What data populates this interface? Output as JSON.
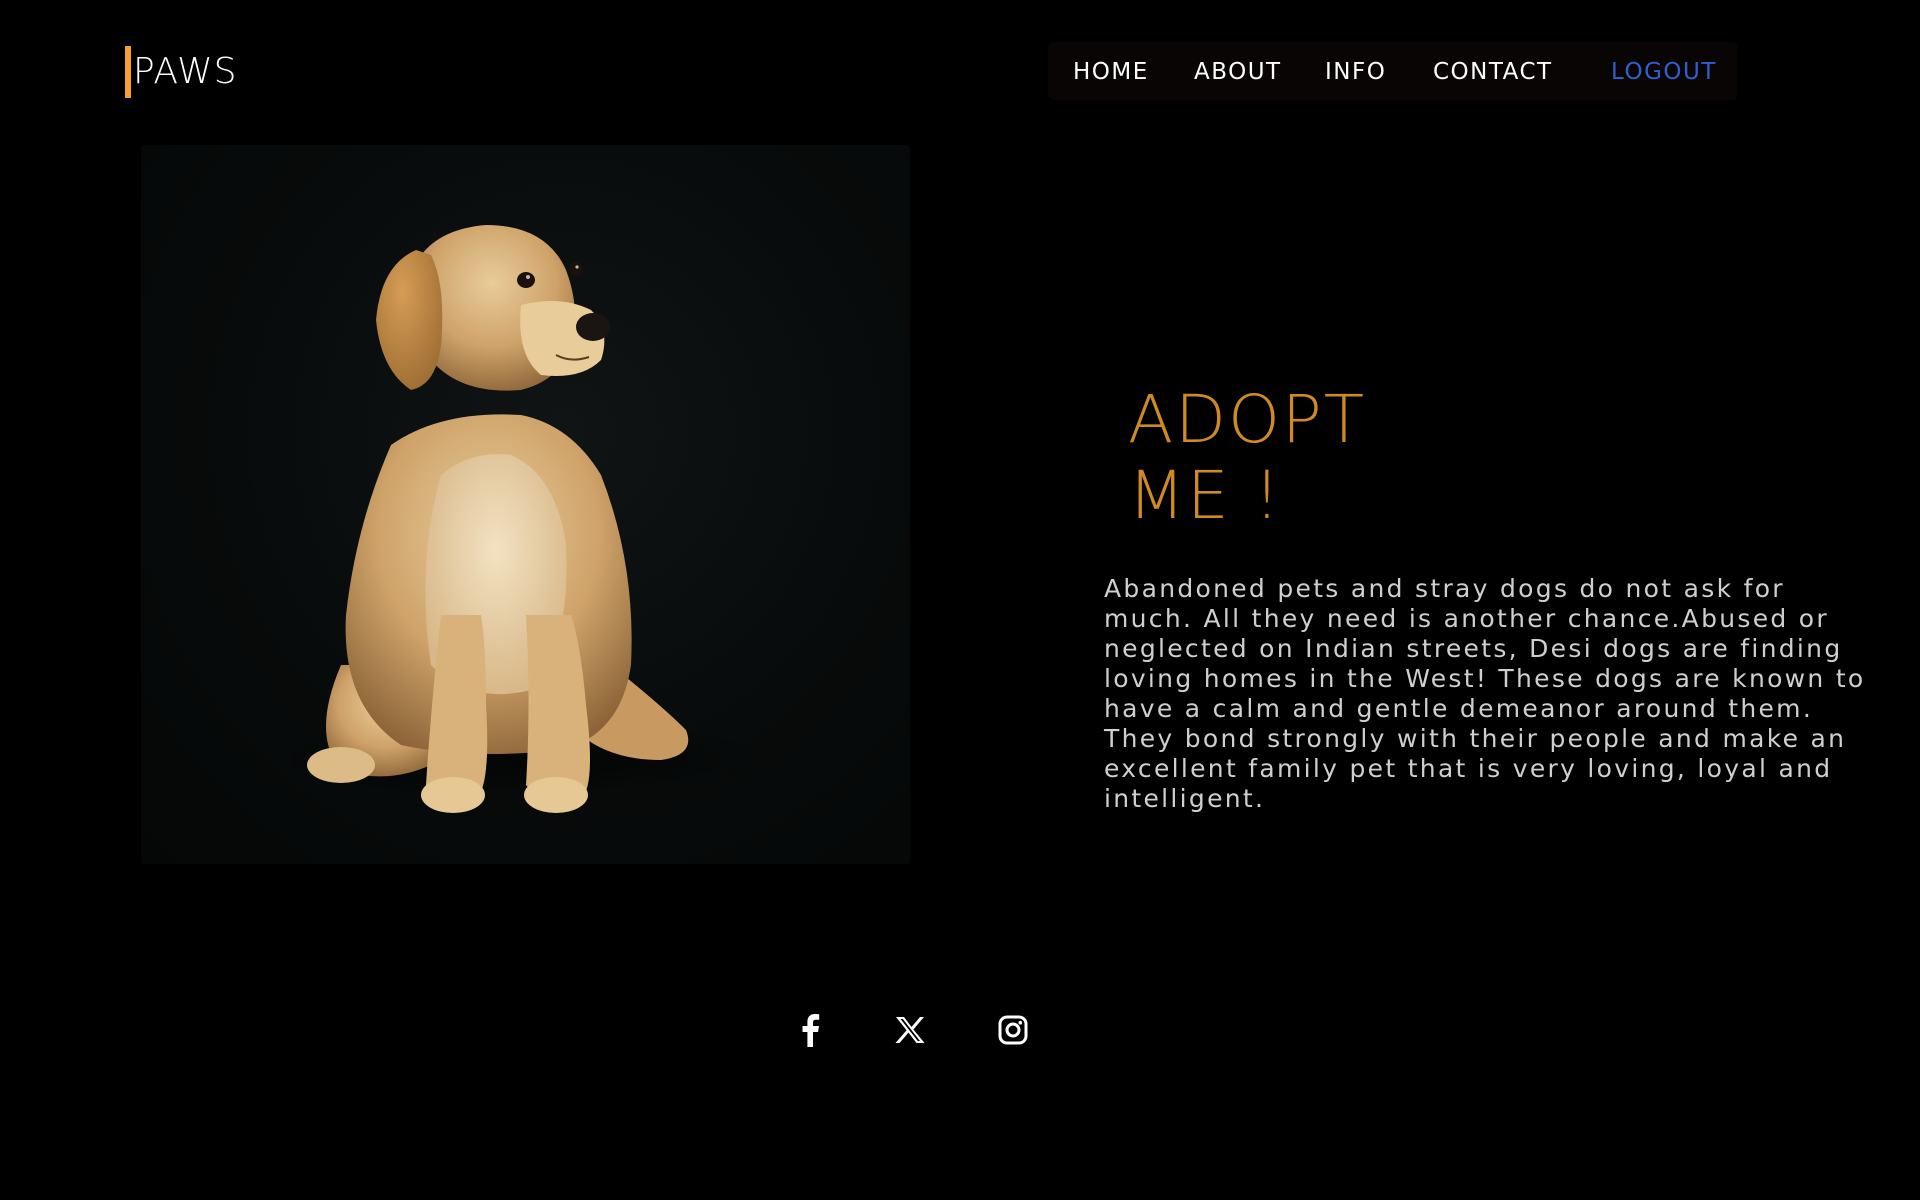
{
  "brand": {
    "name": "PAWS",
    "accent_color": "#f4a22d"
  },
  "nav": {
    "items": [
      {
        "label": "HOME"
      },
      {
        "label": "ABOUT"
      },
      {
        "label": "INFO"
      },
      {
        "label": "CONTACT"
      },
      {
        "label": "LOGOUT"
      }
    ],
    "logout_color": "#2f5fd0"
  },
  "hero": {
    "image": "labrador-puppy-photo",
    "heading_line1": "ADOPT",
    "heading_line2": "ME !",
    "heading_color": "#d08a23",
    "description": "Abandoned pets and stray dogs do not ask for much. All they need is another chance.Abused or neglected on Indian streets, Desi dogs are finding loving homes in the West! These dogs are known to have a calm and gentle demeanor around them. They bond strongly with their people and make an excellent family pet that is very loving, loyal and intelligent."
  },
  "social": {
    "icons": [
      "facebook-icon",
      "x-twitter-icon",
      "instagram-icon"
    ]
  }
}
